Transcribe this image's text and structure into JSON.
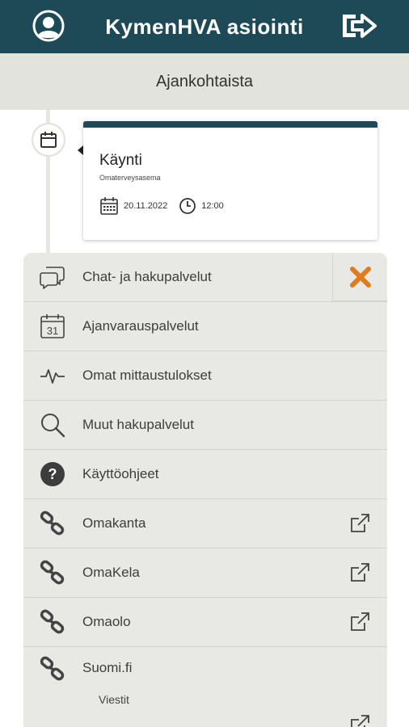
{
  "header": {
    "title": "KymenHVA asiointi",
    "avatar_icon": "user-circle-icon",
    "logout_icon": "logout-icon"
  },
  "subheader": {
    "title": "Ajankohtaista"
  },
  "card": {
    "title": "Käynti",
    "subtitle": "Omaterveysasema",
    "date": "20.11.2022",
    "time": "12:00"
  },
  "menu": {
    "items": [
      {
        "label": "Chat- ja hakupalvelut",
        "icon": "chat-icon"
      },
      {
        "label": "Ajanvarauspalvelut",
        "icon": "calendar-31-icon"
      },
      {
        "label": "Omat mittaustulokset",
        "icon": "pulse-icon"
      },
      {
        "label": "Muut hakupalvelut",
        "icon": "search-icon"
      },
      {
        "label": "Käyttöohjeet",
        "icon": "help-icon"
      },
      {
        "label": "Omakanta",
        "icon": "link-icon",
        "external": true
      },
      {
        "label": "OmaKela",
        "icon": "link-icon",
        "external": true
      },
      {
        "label": "Omaolo",
        "icon": "link-icon",
        "external": true
      },
      {
        "label": "Suomi.fi",
        "icon": "link-icon",
        "external": true,
        "sublabel": "Viestit"
      }
    ]
  },
  "colors": {
    "header_bg": "#1d4a56",
    "subheader_bg": "#e3e3de",
    "menu_bg": "#e8e8e4",
    "close_accent": "#e07b1f"
  }
}
